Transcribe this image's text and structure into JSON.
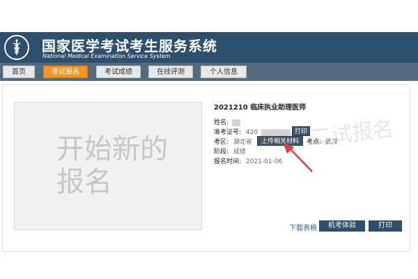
{
  "header": {
    "title": "国家医学考试考生服务系统",
    "subtitle": "National Medical Examination Service System"
  },
  "nav": {
    "tabs": [
      {
        "label": "首页"
      },
      {
        "label": "考试报名"
      },
      {
        "label": "考试成绩"
      },
      {
        "label": "在线评测"
      },
      {
        "label": "个人信息"
      }
    ],
    "active_index": 1
  },
  "card": {
    "photo_placeholder": "开始新的报名",
    "exam_title": "2021210 临床执业助理医师",
    "fields": {
      "name_label": "姓名:",
      "ticket_label": "准考证号:",
      "ticket_value": "420",
      "region_label": "考区:",
      "region_value": "湖北省",
      "site_label": "考点:",
      "site_value": "武汉",
      "stage_label": "阶段:",
      "stage_value": "成绩",
      "time_label": "报名时间:",
      "time_value": "2021-01-06"
    },
    "print_small_label": "打印",
    "upload_label": "上传相关材料",
    "download_link": "下载表格",
    "exam_experience_label": "机考体验",
    "print_label": "打印"
  },
  "watermark": "二试报名",
  "colors": {
    "header_bg": "#2b4f6c",
    "nav_bg": "#546b7e",
    "active_tab": "#f7941d",
    "arrow": "#e23b3b"
  }
}
